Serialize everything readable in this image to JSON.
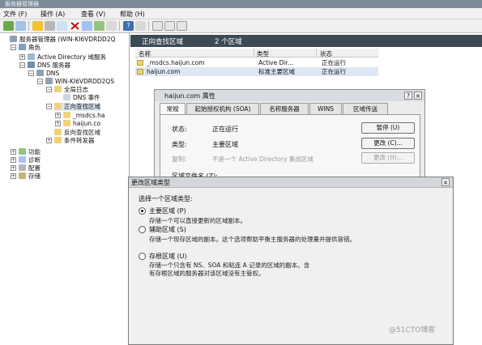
{
  "window": {
    "title": "服务器管理器"
  },
  "menu": [
    "文件 (F)",
    "操作 (A)",
    "查看 (V)",
    "帮助 (H)"
  ],
  "colors": {
    "header_dark": "#3c4a56",
    "selection": "#dde7f3",
    "folder": "#f0d27a",
    "server": "#8fa0b0"
  },
  "tree": [
    {
      "label": "服务器管理器 (WIN-KI6VDRDD2Q",
      "icon": "server-manager-icon",
      "expand": ""
    },
    {
      "label": "角色",
      "icon": "roles-icon",
      "expand": "−"
    },
    {
      "label": "Active Directory 域服务",
      "icon": "active-directory-icon",
      "expand": "+"
    },
    {
      "label": "DNS 服务器",
      "icon": "dns-server-icon",
      "expand": "−"
    },
    {
      "label": "DNS",
      "icon": "dns-icon",
      "expand": "−"
    },
    {
      "label": "WIN-KI6VDRDD2QS",
      "icon": "computer-icon",
      "expand": "−"
    },
    {
      "label": "全局日志",
      "icon": "folder-icon",
      "expand": "−"
    },
    {
      "label": "DNS 事件",
      "icon": "log-icon",
      "expand": ""
    },
    {
      "label": "正向查找区域",
      "icon": "folder-icon",
      "expand": "−"
    },
    {
      "label": "_msdcs.ha",
      "icon": "zone-icon",
      "expand": "+"
    },
    {
      "label": "haijun.co",
      "icon": "zone-icon",
      "expand": "+"
    },
    {
      "label": "反向查找区域",
      "icon": "folder-icon",
      "expand": ""
    },
    {
      "label": "条件转发器",
      "icon": "folder-icon",
      "expand": "+"
    },
    {
      "label": "功能",
      "icon": "features-icon",
      "expand": "+"
    },
    {
      "label": "诊断",
      "icon": "diagnostics-icon",
      "expand": "+"
    },
    {
      "label": "配置",
      "icon": "configuration-icon",
      "expand": "+"
    },
    {
      "label": "存储",
      "icon": "storage-icon",
      "expand": "+"
    }
  ],
  "main": {
    "header_title": "正向查找区域",
    "header_count": "2 个区域",
    "columns": [
      "名称",
      "类型",
      "状态"
    ],
    "rows": [
      {
        "name": "_msdcs.haijun.com",
        "type": "Active Dir...",
        "status": "正在运行"
      },
      {
        "name": "haijun.com",
        "type": "标准主要区域",
        "status": "正在运行"
      }
    ]
  },
  "properties_dialog": {
    "title": "haijun.com 属性",
    "help": "?",
    "close": "×",
    "tabs": [
      "常规",
      "起始授权机构 (SOA)",
      "名称服务器",
      "WINS",
      "区域传送"
    ],
    "status_label": "状态:",
    "status_value": "正在运行",
    "pause_button": "暂停 (U)",
    "type_label": "类型:",
    "type_value": "主要区域",
    "change_button": "更改 (C)...",
    "replication_label": "复制:",
    "replication_value": "不是一个 Active Directory 集成区域",
    "change_replication_button": "更改 (H)...",
    "zone_file_label": "区域文件名 (Z):"
  },
  "change_zone_dialog": {
    "title": "更改区域类型",
    "close": "×",
    "prompt": "选择一个区域类型:",
    "options": [
      {
        "label": "主要区域 (P)",
        "desc": [
          "存储一个可以直接更新的区域副本。"
        ],
        "selected": true
      },
      {
        "label": "辅助区域 (S)",
        "desc": [
          "存储一个现存区域的副本。这个选项帮助平衡主服务器的处理量并提供容错。"
        ],
        "selected": false
      },
      {
        "label": "存根区域 (U)",
        "desc": [
          "存储一个只含有 NS、SOA 和粘连 A 记录的区域的副本。含",
          "有存根区域的服务器对该区域没有主管权。"
        ],
        "selected": false
      }
    ]
  },
  "watermark": "@51CTO博客"
}
